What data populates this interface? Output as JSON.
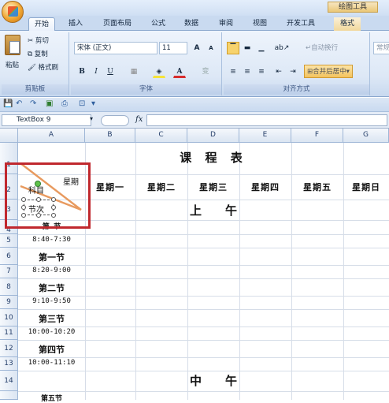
{
  "ribbon_tabs": {
    "home": "开始",
    "insert": "插入",
    "layout": "页面布局",
    "formulas": "公式",
    "data": "数据",
    "review": "审阅",
    "view": "视图",
    "developer": "开发工具",
    "format": "格式"
  },
  "context_tab": "绘图工具",
  "clipboard": {
    "paste": "粘贴",
    "cut": "剪切",
    "copy": "复制",
    "format_painter": "格式刷",
    "group": "剪贴板"
  },
  "font": {
    "name": "宋体 (正文)",
    "size": "11",
    "bold": "B",
    "italic": "I",
    "underline": "U",
    "grow": "A",
    "shrink": "A",
    "font_color": "A",
    "wen": "变",
    "group": "字体"
  },
  "alignment": {
    "wrap": "自动换行",
    "merge": "合并后居中",
    "group": "对齐方式"
  },
  "number": {
    "format": "常规"
  },
  "formula_bar": {
    "name_box": "TextBox 9",
    "fx": "fx",
    "value": ""
  },
  "columns": [
    "A",
    "B",
    "C",
    "D",
    "E",
    "F",
    "G"
  ],
  "rows": [
    "1",
    "2",
    "3",
    "4",
    "5",
    "6",
    "7",
    "8",
    "9",
    "10",
    "11",
    "12",
    "13",
    "14"
  ],
  "sheet": {
    "title": "课 程 表",
    "header_day": "星期",
    "header_subject": "科目",
    "header_period": "节次",
    "days": [
      "星期一",
      "星期二",
      "星期三",
      "星期四",
      "星期五",
      "星期日"
    ],
    "morning": "上　　午",
    "noon": "中　　午",
    "slots": [
      {
        "label": "第一节",
        "time": "8:40-7:30"
      },
      {
        "label": "第一节",
        "time": "8:20-9:00"
      },
      {
        "label": "第二节",
        "time": "9:10-9:50"
      },
      {
        "label": "第三节",
        "time": "10:00-10:20"
      },
      {
        "label": "第四节",
        "time": "10:00-11:10"
      }
    ],
    "row4_partial": "第 节",
    "row15_partial": "第五节"
  }
}
